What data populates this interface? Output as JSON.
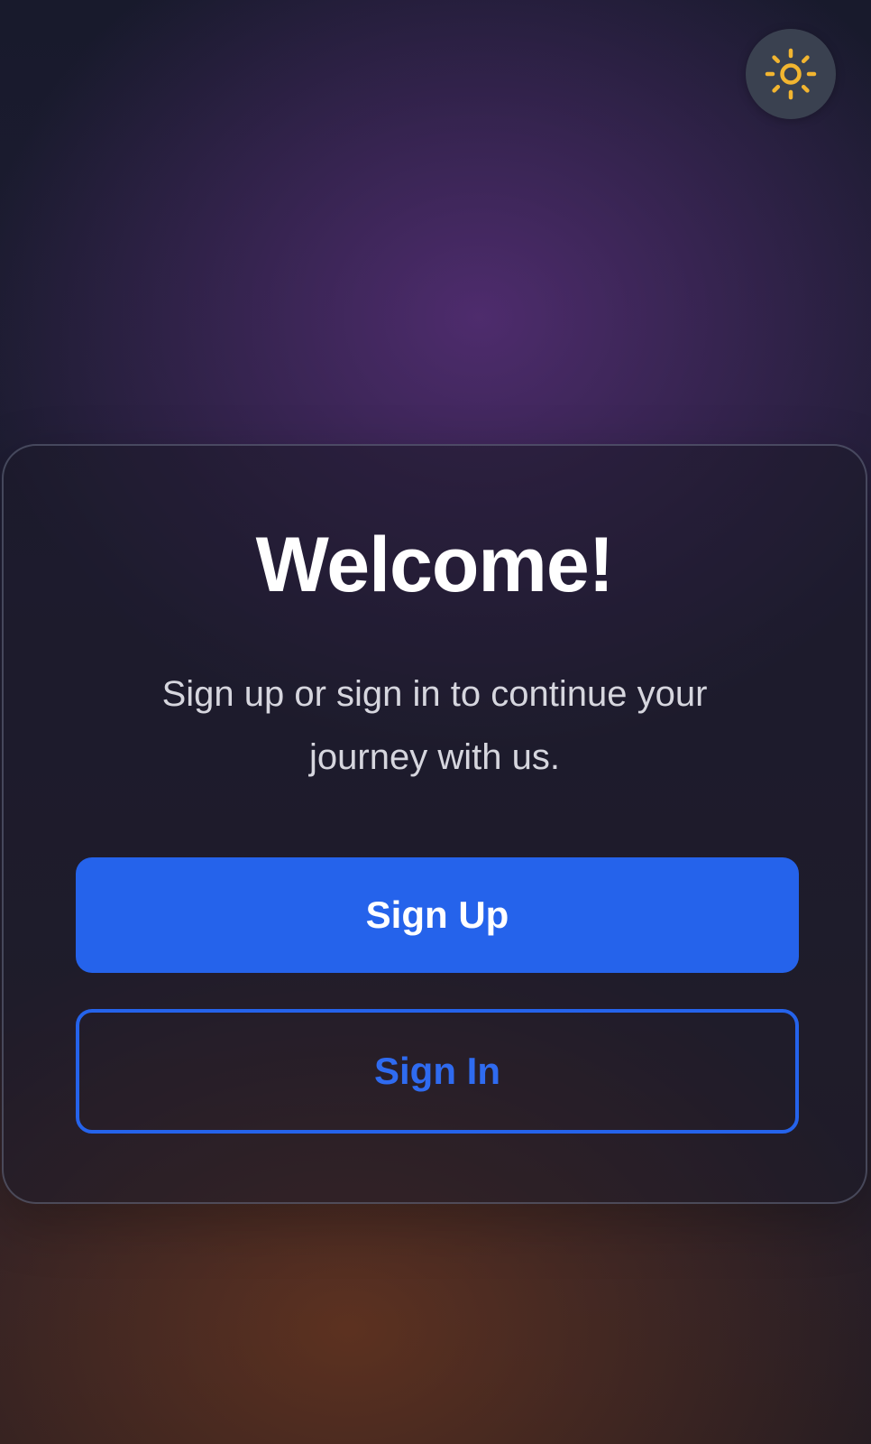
{
  "theme_toggle": {
    "icon": "sun-icon",
    "icon_color": "#f2b530"
  },
  "card": {
    "title": "Welcome!",
    "subtitle": "Sign up or sign in to continue your journey with us.",
    "sign_up_label": "Sign Up",
    "sign_in_label": "Sign In"
  },
  "colors": {
    "accent": "#2563eb",
    "text_primary": "#ffffff",
    "text_secondary": "#d6d6de"
  }
}
